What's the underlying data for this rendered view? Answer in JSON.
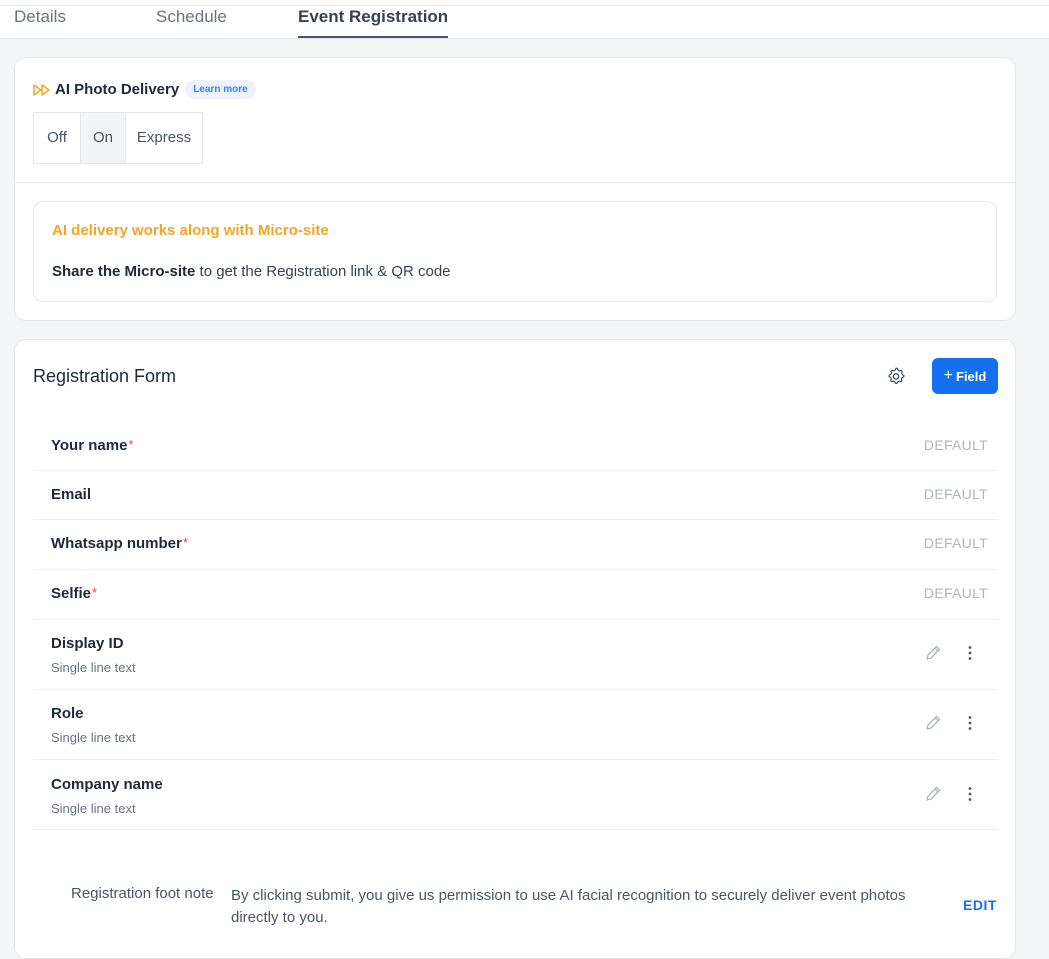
{
  "tabs": {
    "details": "Details",
    "schedule": "Schedule",
    "event_registration": "Event Registration"
  },
  "ai_delivery": {
    "title": "AI Photo Delivery",
    "learn_more": "Learn more",
    "options": [
      "Off",
      "On",
      "Express"
    ],
    "selected": "On",
    "icon": "fast-forward-icon",
    "accent_color": "#f5a524"
  },
  "notice": {
    "title": "AI delivery works along with Micro-site",
    "bold": "Share the Micro-site",
    "text": " to get the Registration link & QR code"
  },
  "form": {
    "title": "Registration Form",
    "add_button": "Field",
    "add_button_icon": "plus-icon",
    "button_color": "#1570ef",
    "required_mark": "*",
    "fields": [
      {
        "label": "Your name",
        "required": true,
        "tag": "DEFAULT"
      },
      {
        "label": "Email",
        "required": false,
        "tag": "DEFAULT"
      },
      {
        "label": "Whatsapp number",
        "required": true,
        "tag": "DEFAULT"
      },
      {
        "label": "Selfie",
        "required": true,
        "tag": "DEFAULT"
      },
      {
        "label": "Display ID",
        "type": "Single line text"
      },
      {
        "label": "Role",
        "type": "Single line text"
      },
      {
        "label": "Company name",
        "type": "Single line text"
      }
    ],
    "foot_note_label": "Registration foot note",
    "foot_note_text": "By clicking submit, you give us permission to use AI facial recognition to securely deliver event photos directly to you.",
    "edit_label": "EDIT"
  }
}
